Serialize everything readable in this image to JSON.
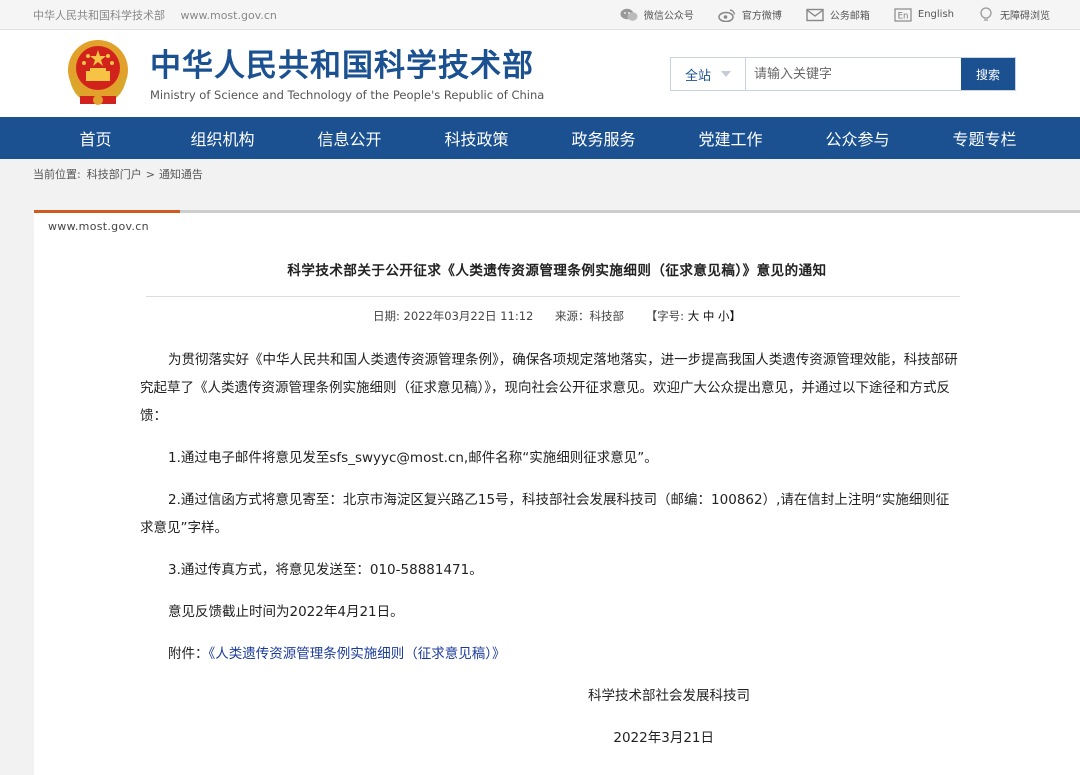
{
  "topbar": {
    "site_name": "中华人民共和国科学技术部",
    "site_url": "www.most.gov.cn",
    "links": [
      {
        "label": "微信公众号",
        "icon": "wechat-icon"
      },
      {
        "label": "官方微博",
        "icon": "weibo-icon"
      },
      {
        "label": "公务邮箱",
        "icon": "mail-icon"
      },
      {
        "label": "English",
        "icon": "english-icon"
      },
      {
        "label": "无障碍浏览",
        "icon": "accessibility-icon"
      }
    ]
  },
  "header": {
    "title_cn": "中华人民共和国科学技术部",
    "title_en": "Ministry of Science and Technology of the People's Republic of China",
    "search": {
      "scope": "全站",
      "placeholder": "请输入关键字",
      "button": "搜索"
    }
  },
  "nav": [
    "首页",
    "组织机构",
    "信息公开",
    "科技政策",
    "政务服务",
    "党建工作",
    "公众参与",
    "专题专栏"
  ],
  "breadcrumb": {
    "label": "当前位置:",
    "items": [
      "科技部门户",
      ">",
      "通知通告"
    ]
  },
  "article": {
    "site_label": "www.most.gov.cn",
    "title": "科学技术部关于公开征求《人类遗传资源管理条例实施细则（征求意见稿）》意见的通知",
    "meta": {
      "date": "日期:  2022年03月22日   11:12",
      "source": "来源：科技部",
      "font_label": "【字号:",
      "font_large": "大",
      "font_medium": "中",
      "font_small": "小】"
    },
    "paragraphs": [
      "为贯彻落实好《中华人民共和国人类遗传资源管理条例》，确保各项规定落地落实，进一步提高我国人类遗传资源管理效能，科技部研究起草了《人类遗传资源管理条例实施细则（征求意见稿）》，现向社会公开征求意见。欢迎广大公众提出意见，并通过以下途径和方式反馈：",
      "1.通过电子邮件将意见发至sfs_swyyc@most.cn,邮件名称“实施细则征求意见”。",
      "2.通过信函方式将意见寄至：北京市海淀区复兴路乙15号，科技部社会发展科技司（邮编：100862）,请在信封上注明“实施细则征求意见”字样。",
      "3.通过传真方式，将意见发送至：010-58881471。",
      "意见反馈截止时间为2022年4月21日。"
    ],
    "attachment_label": "附件：",
    "attachment_link": "《人类遗传资源管理条例实施细则（征求意见稿）》",
    "signature": "科学技术部社会发展科技司",
    "sign_date": "2022年3月21日"
  },
  "colors": {
    "brand_blue": "#1b5191",
    "accent_orange": "#d05b1e",
    "link_blue": "#1b3c9c"
  }
}
